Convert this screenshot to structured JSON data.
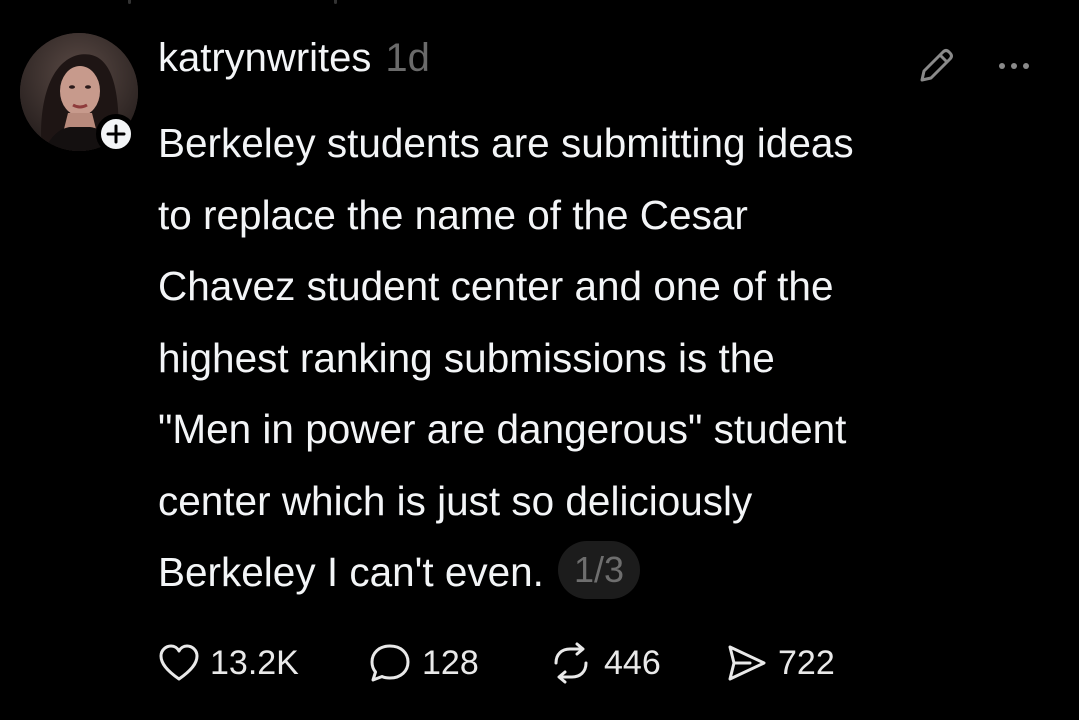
{
  "post": {
    "username": "katrynwrites",
    "timestamp": "1d",
    "body": "Berkeley students are submitting ideas\nto replace the name of the Cesar\nChavez student center and one of the\nhighest ranking submissions is the\n\"Men in power are dangerous\" student\ncenter which is just so deliciously\nBerkeley I can't even.",
    "page_indicator": "1/3"
  },
  "actions": {
    "likes": "13.2K",
    "replies": "128",
    "reposts": "446",
    "shares": "722"
  },
  "colors": {
    "background": "#000000",
    "text": "#f3f5f7",
    "muted": "#6a6a6a"
  },
  "icons": {
    "follow": "plus-icon",
    "edit": "pencil-icon",
    "more": "more-icon",
    "like": "heart-icon",
    "reply": "comment-icon",
    "repost": "repost-icon",
    "share": "send-icon"
  }
}
